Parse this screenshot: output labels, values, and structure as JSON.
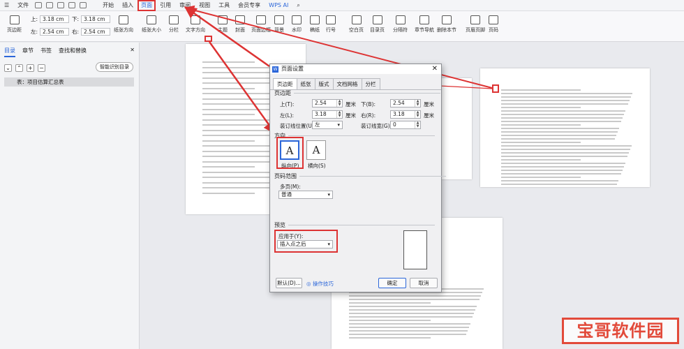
{
  "menubar": {
    "file": "文件",
    "items": [
      "开始",
      "插入",
      "页面",
      "引用",
      "审阅",
      "视图",
      "工具",
      "会员专享"
    ],
    "ai": "WPS AI"
  },
  "ribbon": {
    "margins_label": "页边距",
    "top_label": "上:",
    "top_value": "3.18 cm",
    "bottom_label": "下:",
    "bottom_value": "3.18 cm",
    "left_label": "左:",
    "left_value": "2.54 cm",
    "right_label": "右:",
    "right_value": "2.54 cm",
    "tools": [
      "纸张方向",
      "纸张大小",
      "分栏",
      "文字方向",
      "主题",
      "封面",
      "页面边框",
      "背景",
      "水印",
      "稿纸",
      "行号",
      "空白页",
      "目录页",
      "分隔符",
      "章节导航",
      "删除本节",
      "页眉页脚",
      "页码"
    ]
  },
  "leftpane": {
    "tabs": [
      "目录",
      "章节",
      "书签",
      "查找和替换"
    ],
    "smart_btn": "智能识别目录",
    "item": "表：项目估算汇总表"
  },
  "dialog": {
    "title": "页面设置",
    "tabs": [
      "页边距",
      "纸张",
      "版式",
      "文档网格",
      "分栏"
    ],
    "margins_section": "页边距",
    "top_label": "上(T):",
    "top_value": "2.54",
    "bottom_label": "下(B):",
    "bottom_value": "2.54",
    "left_label": "左(L):",
    "left_value": "3.18",
    "right_label": "右(R):",
    "right_value": "3.18",
    "unit": "厘米",
    "gutter_pos_label": "装订线位置(U):",
    "gutter_pos_value": "左",
    "gutter_width_label": "装订线宽(G):",
    "gutter_width_value": "0",
    "orientation_section": "方向",
    "portrait": "纵向(P)",
    "landscape": "横向(S)",
    "pages_section": "页码范围",
    "multi_pages_label": "多页(M):",
    "multi_pages_value": "普通",
    "preview_section": "预览",
    "apply_label": "应用于(Y):",
    "apply_value": "插入点之后",
    "default_btn": "默认(D)...",
    "tips": "操作技巧",
    "ok": "确定",
    "cancel": "取消"
  },
  "watermark": "宝哥软件园"
}
